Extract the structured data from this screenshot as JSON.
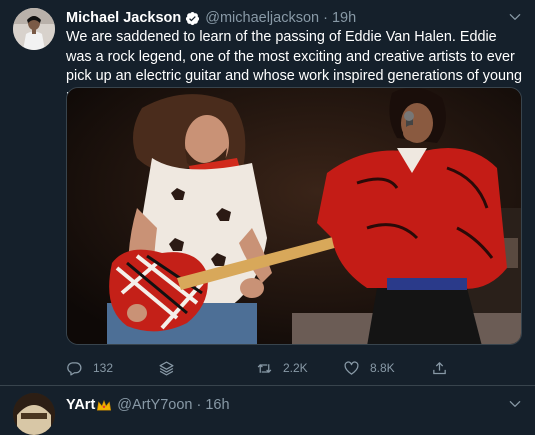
{
  "tweet": {
    "author_name": "Michael Jackson",
    "handle": "@michaeljackson",
    "separator": "·",
    "time": "19h",
    "text": "We are saddened to learn of the passing of Eddie Van Halen. Eddie was a rock legend, one of the most exciting and creative artists to ever pick up an electric guitar and whose work inspired generations of young musicians.",
    "actions": {
      "replies": "132",
      "retweets": "2.2K",
      "likes": "8.8K"
    }
  },
  "next_tweet": {
    "author_name": "YArt",
    "handle": "@ArtY7oon",
    "separator": "·",
    "time": "16h"
  },
  "colors": {
    "background": "#15202b",
    "secondary_text": "#8899a6",
    "verified_blue": "#ffffff",
    "border": "#38444d"
  },
  "icons": {
    "verified": "verified-badge-icon",
    "caret": "chevron-down-icon",
    "reply": "reply-icon",
    "layers": "layers-icon",
    "retweet": "retweet-icon",
    "like": "heart-icon",
    "share": "share-icon",
    "crown": "crown-emoji-icon"
  }
}
